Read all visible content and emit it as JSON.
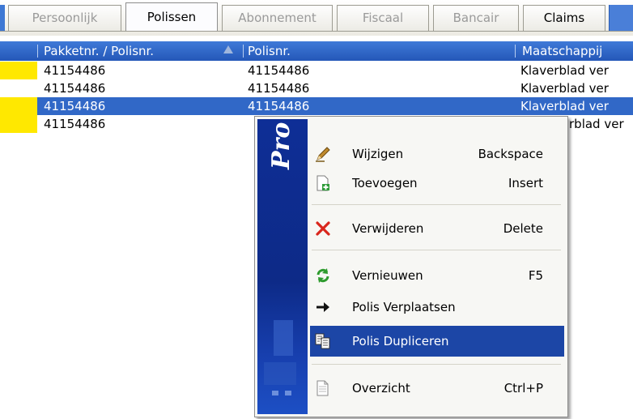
{
  "tabs": [
    {
      "label": "Persoonlijk"
    },
    {
      "label": "Polissen"
    },
    {
      "label": "Abonnement"
    },
    {
      "label": "Fiscaal"
    },
    {
      "label": "Bancair"
    },
    {
      "label": "Claims"
    }
  ],
  "grid": {
    "columns": [
      "Pakketnr. / Polisnr.",
      "Polisnr.",
      "Maatschappij"
    ],
    "rows": [
      {
        "pakket": "41154486",
        "polis": "41154486",
        "maatschappij": "Klaverblad ver",
        "marker_color": "#ffe800"
      },
      {
        "pakket": "41154486",
        "polis": "41154486",
        "maatschappij": "Klaverblad ver",
        "marker_color": ""
      },
      {
        "pakket": "41154486",
        "polis": "41154486",
        "maatschappij": "Klaverblad ver",
        "marker_color": "#ffe800",
        "selected": true
      },
      {
        "pakket": "41154486",
        "polis": "",
        "maatschappij": "rblad ver",
        "marker_color": "#ffe800"
      }
    ]
  },
  "context_menu": {
    "brand": "Pro",
    "items": [
      {
        "label": "Wijzigen",
        "shortcut": "Backspace",
        "icon": "pencil-icon"
      },
      {
        "label": "Toevoegen",
        "shortcut": "Insert",
        "icon": "add-document-icon"
      },
      {
        "label": "Verwijderen",
        "shortcut": "Delete",
        "icon": "red-x-icon"
      },
      {
        "label": "Vernieuwen",
        "shortcut": "F5",
        "icon": "refresh-icon"
      },
      {
        "label": "Polis Verplaatsen",
        "shortcut": "",
        "icon": "arrow-right-icon"
      },
      {
        "label": "Polis Dupliceren",
        "shortcut": "",
        "icon": "copy-icon"
      },
      {
        "label": "Overzicht",
        "shortcut": "Ctrl+P",
        "icon": "document-icon"
      }
    ]
  },
  "colors": {
    "accent": "#3168c7",
    "menu_highlight": "#1c46a6",
    "marker_yellow": "#ffe800"
  }
}
